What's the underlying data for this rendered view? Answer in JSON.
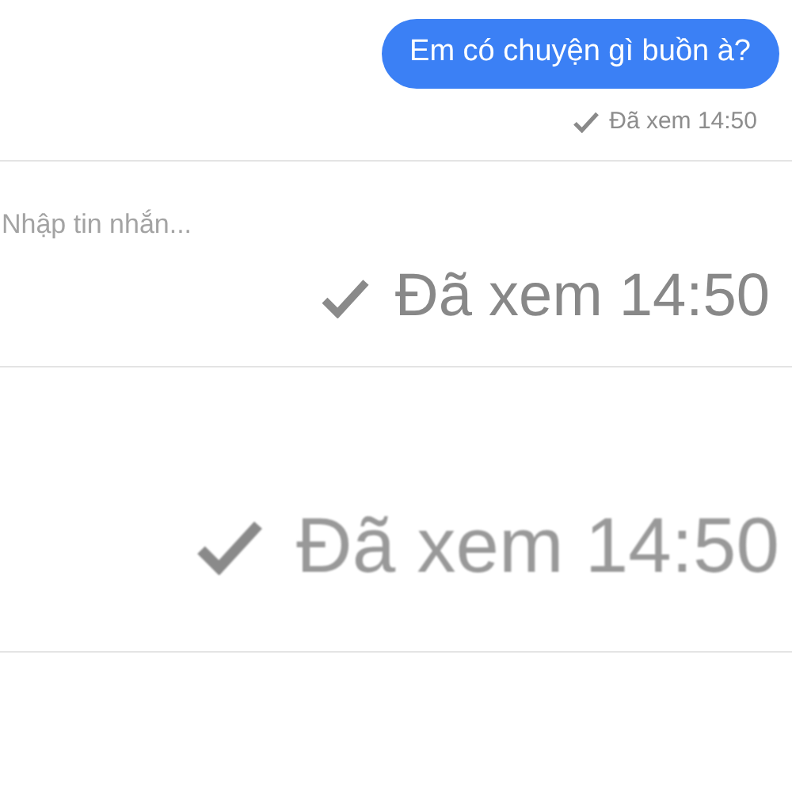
{
  "message": {
    "text": "Em có chuyện gì buồn à?"
  },
  "seen_status": {
    "text": "Đã xem 14:50"
  },
  "composer": {
    "placeholder": "Nhập tin nhắn..."
  },
  "zoomed_seen_statuses": [
    {
      "text": "Đã xem 14:50"
    },
    {
      "text": "Đã xem 14:50"
    }
  ]
}
